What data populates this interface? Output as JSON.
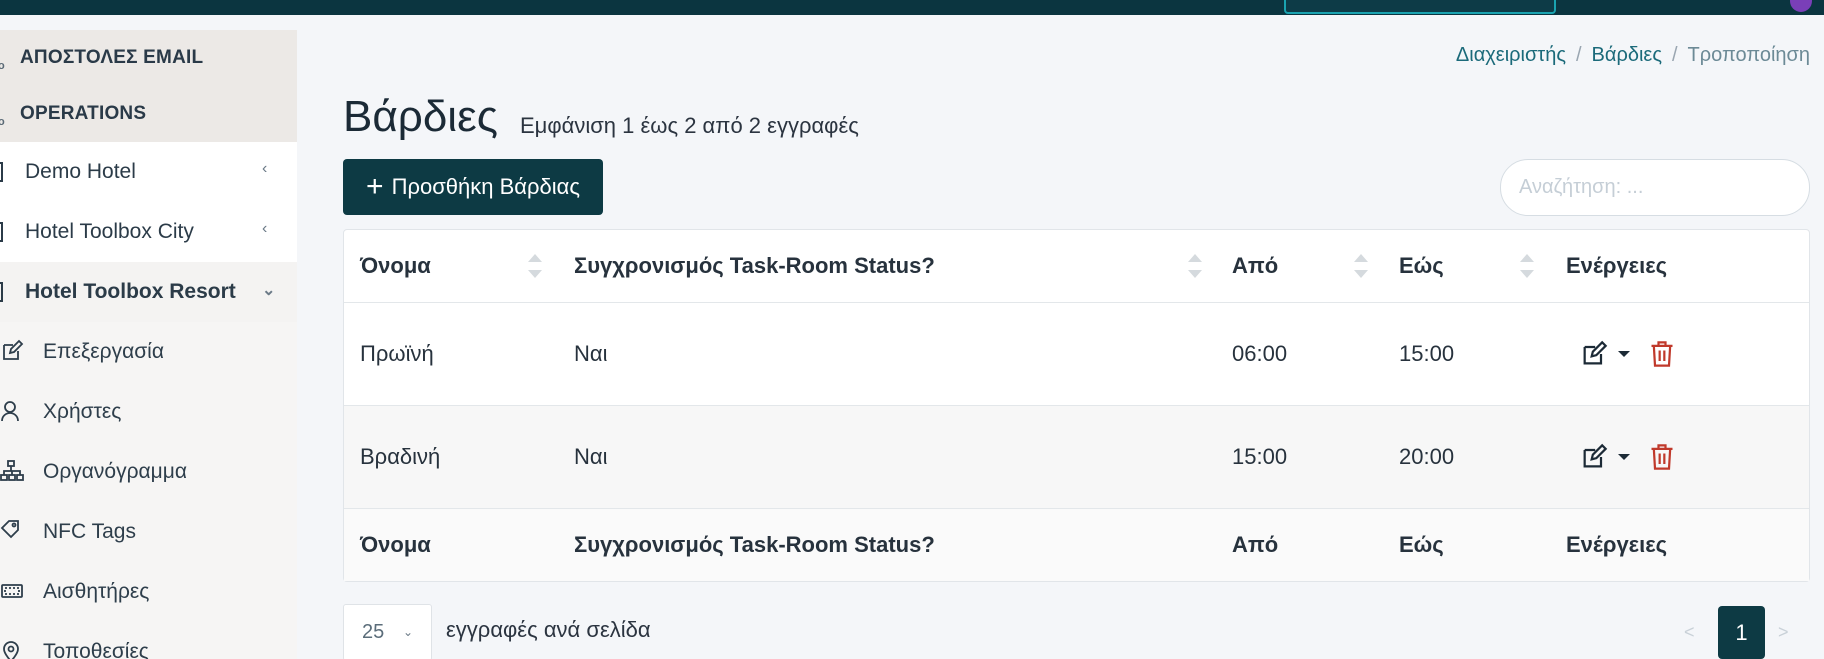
{
  "topbar": {},
  "sidebar": {
    "sections": [
      {
        "label": "ΑΠΟΣΤΟΛΕΣ EMAIL"
      },
      {
        "label": "OPERATIONS"
      }
    ],
    "hotels": [
      {
        "label": "Demo Hotel",
        "chevron": "‹"
      },
      {
        "label": "Hotel Toolbox City",
        "chevron": "‹"
      },
      {
        "label": "Hotel Toolbox Resort",
        "chevron": "⌄"
      }
    ],
    "sub_items": [
      {
        "label": "Επεξεργασία",
        "icon": "edit-icon"
      },
      {
        "label": "Χρήστες",
        "icon": "user-icon"
      },
      {
        "label": "Οργανόγραμμα",
        "icon": "sitemap-icon"
      },
      {
        "label": "NFC Tags",
        "icon": "tag-icon"
      },
      {
        "label": "Αισθητήρες",
        "icon": "sensor-icon"
      },
      {
        "label": "Τοποθεσίες",
        "icon": "location-icon"
      }
    ]
  },
  "breadcrumb": {
    "items": [
      "Διαχειριστής",
      "Βάρδιες"
    ],
    "current": "Τροποποίηση",
    "separator": "/"
  },
  "page": {
    "title": "Βάρδιες",
    "subtitle": "Εμφάνιση 1 έως 2 από 2 εγγραφές"
  },
  "toolbar": {
    "add_label": "Προσθήκη Βάρδιας",
    "search_placeholder": "Αναζήτηση: ..."
  },
  "table": {
    "columns": [
      "Όνομα",
      "Συγχρονισμός Task-Room Status?",
      "Από",
      "Εώς",
      "Ενέργειες"
    ],
    "rows": [
      {
        "name": "Πρωϊνή",
        "sync": "Ναι",
        "from": "06:00",
        "to": "15:00"
      },
      {
        "name": "Βραδινή",
        "sync": "Ναι",
        "from": "15:00",
        "to": "20:00"
      }
    ]
  },
  "footer": {
    "page_length": "25",
    "page_length_label": "εγγραφές ανά σελίδα",
    "pagination": {
      "prev": "<",
      "current": "1",
      "next": ">"
    }
  },
  "colors": {
    "primary": "#0d3a44",
    "link": "#1b6a7a",
    "danger": "#c0392b"
  }
}
